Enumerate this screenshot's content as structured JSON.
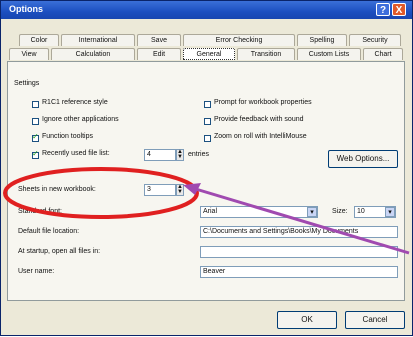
{
  "window": {
    "title": "Options",
    "help_label": "?",
    "close_label": "X"
  },
  "tabs": {
    "top": [
      {
        "label": "Color"
      },
      {
        "label": "International"
      },
      {
        "label": "Save"
      },
      {
        "label": "Error Checking"
      },
      {
        "label": "Spelling"
      },
      {
        "label": "Security"
      }
    ],
    "bottom": [
      {
        "label": "View"
      },
      {
        "label": "Calculation"
      },
      {
        "label": "Edit"
      },
      {
        "label": "General"
      },
      {
        "label": "Transition"
      },
      {
        "label": "Custom Lists"
      },
      {
        "label": "Chart"
      }
    ]
  },
  "settings": {
    "heading": "Settings",
    "r1c1_ref": {
      "label": "R1C1 reference style",
      "checked": false
    },
    "ignore_apps": {
      "label": "Ignore other applications",
      "checked": false
    },
    "function_tooltips": {
      "label": "Function tooltips",
      "checked": true
    },
    "recently_used": {
      "label": "Recently used file list:",
      "checked": true,
      "value": "4",
      "suffix": "entries"
    },
    "prompt_props": {
      "label": "Prompt for workbook properties",
      "checked": false
    },
    "feedback_sound": {
      "label": "Provide feedback with sound",
      "checked": false
    },
    "zoom_intellimouse": {
      "label": "Zoom on roll with IntelliMouse",
      "checked": false
    },
    "web_options_button": "Web Options...",
    "sheets_in_new": {
      "label": "Sheets in new workbook:",
      "value": "3"
    },
    "standard_font": {
      "label": "Standard font:",
      "value": "Arial",
      "size_label": "Size:",
      "size_value": "10"
    },
    "default_location": {
      "label": "Default file location:",
      "value": "C:\\Documents and Settings\\Books\\My Documents"
    },
    "startup_folder": {
      "label": "At startup, open all files in:",
      "value": ""
    },
    "user_name": {
      "label": "User name:",
      "value": "Beaver"
    }
  },
  "buttons": {
    "ok": "OK",
    "cancel": "Cancel"
  },
  "annotations": {
    "ellipse_color": "#e02020",
    "arrow_color": "#a04ab0"
  }
}
